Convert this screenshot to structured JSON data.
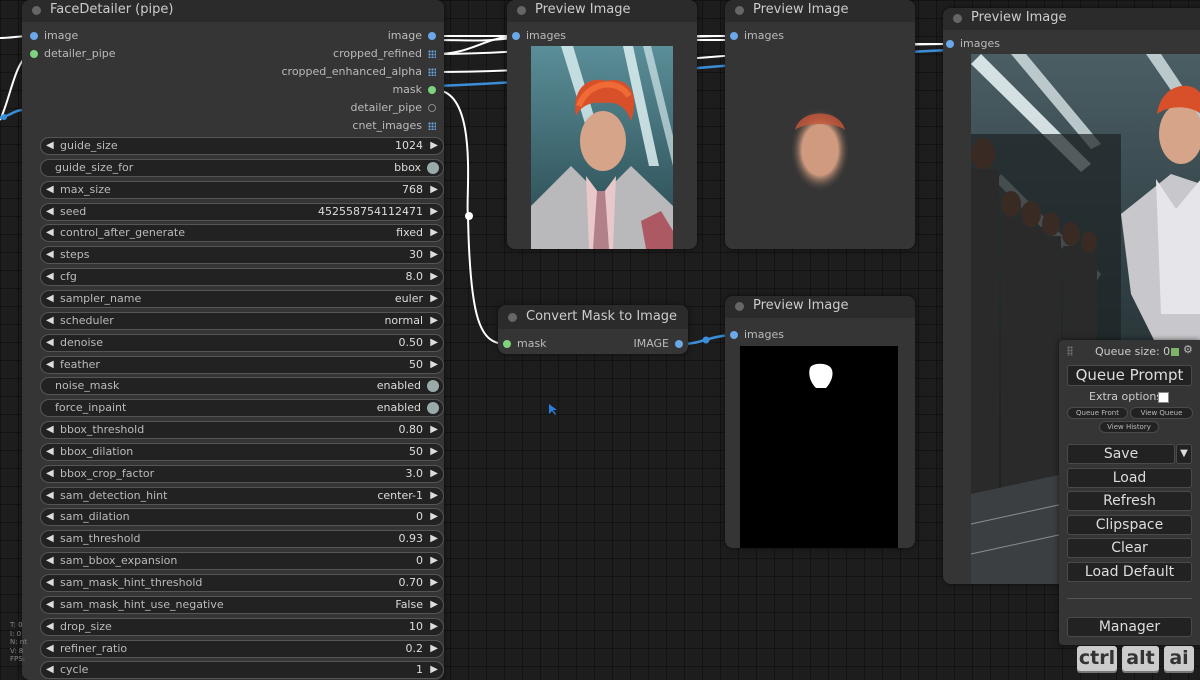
{
  "face_detailer": {
    "title": "FaceDetailer (pipe)",
    "inputs": [
      "image",
      "detailer_pipe"
    ],
    "outputs": [
      "image",
      "cropped_refined",
      "cropped_enhanced_alpha",
      "mask",
      "detailer_pipe",
      "cnet_images"
    ],
    "widgets": [
      {
        "label": "guide_size",
        "value": "1024",
        "type": "number"
      },
      {
        "label": "guide_size_for",
        "value": "bbox",
        "type": "toggle"
      },
      {
        "label": "max_size",
        "value": "768",
        "type": "number"
      },
      {
        "label": "seed",
        "value": "452558754112471",
        "type": "number"
      },
      {
        "label": "control_after_generate",
        "value": "fixed",
        "type": "combo"
      },
      {
        "label": "steps",
        "value": "30",
        "type": "number"
      },
      {
        "label": "cfg",
        "value": "8.0",
        "type": "number"
      },
      {
        "label": "sampler_name",
        "value": "euler",
        "type": "combo"
      },
      {
        "label": "scheduler",
        "value": "normal",
        "type": "combo"
      },
      {
        "label": "denoise",
        "value": "0.50",
        "type": "number"
      },
      {
        "label": "feather",
        "value": "50",
        "type": "number"
      },
      {
        "label": "noise_mask",
        "value": "enabled",
        "type": "toggle"
      },
      {
        "label": "force_inpaint",
        "value": "enabled",
        "type": "toggle"
      },
      {
        "label": "bbox_threshold",
        "value": "0.80",
        "type": "number"
      },
      {
        "label": "bbox_dilation",
        "value": "50",
        "type": "number"
      },
      {
        "label": "bbox_crop_factor",
        "value": "3.0",
        "type": "number"
      },
      {
        "label": "sam_detection_hint",
        "value": "center-1",
        "type": "combo"
      },
      {
        "label": "sam_dilation",
        "value": "0",
        "type": "number"
      },
      {
        "label": "sam_threshold",
        "value": "0.93",
        "type": "number"
      },
      {
        "label": "sam_bbox_expansion",
        "value": "0",
        "type": "number"
      },
      {
        "label": "sam_mask_hint_threshold",
        "value": "0.70",
        "type": "number"
      },
      {
        "label": "sam_mask_hint_use_negative",
        "value": "False",
        "type": "combo"
      },
      {
        "label": "drop_size",
        "value": "10",
        "type": "number"
      },
      {
        "label": "refiner_ratio",
        "value": "0.2",
        "type": "number"
      },
      {
        "label": "cycle",
        "value": "1",
        "type": "number"
      }
    ]
  },
  "preview1": {
    "title": "Preview Image",
    "input": "images"
  },
  "preview2": {
    "title": "Preview Image",
    "input": "images"
  },
  "preview3": {
    "title": "Preview Image",
    "input": "images"
  },
  "preview4": {
    "title": "Preview Image",
    "input": "images"
  },
  "convert_mask": {
    "title": "Convert Mask to Image",
    "input": "mask",
    "output": "IMAGE"
  },
  "queue_panel": {
    "queue_size": "Queue size: 0",
    "queue_prompt": "Queue Prompt",
    "extra_options": "Extra options",
    "queue_front": "Queue Front",
    "view_queue": "View Queue",
    "view_history": "View History",
    "save": "Save",
    "load": "Load",
    "refresh": "Refresh",
    "clipspace": "Clipspace",
    "clear": "Clear",
    "load_default": "Load Default",
    "manager": "Manager"
  },
  "keys": [
    "ctrl",
    "alt",
    "ai"
  ],
  "stats": [
    "T: 0",
    "I: 0",
    "N: nt",
    "V: 8",
    "FPS:"
  ],
  "colors": {
    "image_slot": "#6aa8e8",
    "mask_slot": "#7ed37e",
    "pipe_slot": "#7ed37e",
    "link_white": "#ffffff",
    "link_blue": "#3a8fd8"
  }
}
